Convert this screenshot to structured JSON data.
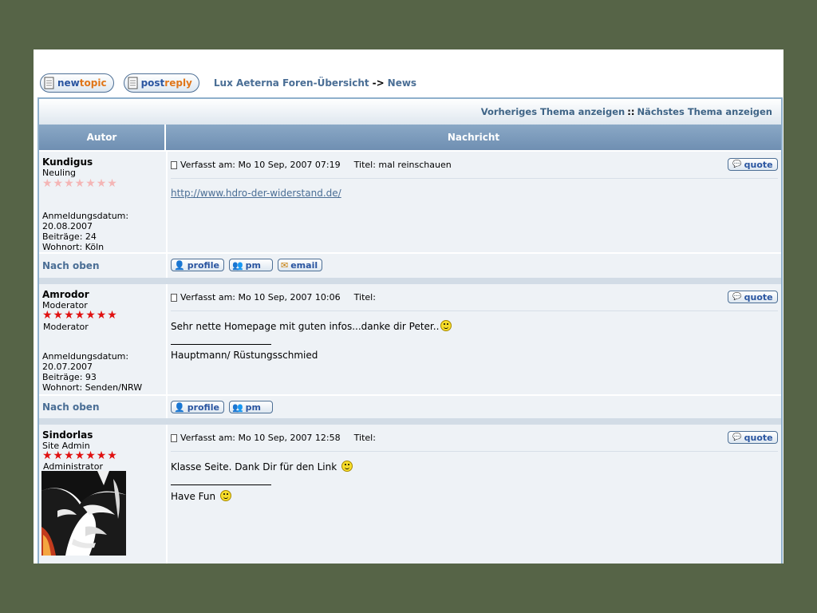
{
  "toolbar": {
    "newtopic_a": "new",
    "newtopic_b": "topic",
    "postreply_a": "post",
    "postreply_b": "reply",
    "breadcrumb_forum": "Lux Aeterna Foren-Übersicht",
    "breadcrumb_sep": "->",
    "breadcrumb_section": "News"
  },
  "nav": {
    "prev": "Vorheriges Thema anzeigen",
    "sep": "::",
    "next": "Nächstes Thema anzeigen"
  },
  "table": {
    "col_author": "Autor",
    "col_message": "Nachricht",
    "back_to_top": "Nach oben",
    "quote_label": "quote",
    "profile_label": "profile",
    "pm_label": "pm",
    "email_label": "email"
  },
  "posts": [
    {
      "author": "Kundigus",
      "rank": "Neuling",
      "stars": "★★★★★★★",
      "reg_label": "Anmeldungsdatum:",
      "reg_date": "20.08.2007",
      "posts_line": "Beiträge: 24",
      "location_line": "Wohnort: Köln",
      "meta": "Verfasst am: Mo 10 Sep, 2007 07:19",
      "title_line": "Titel: mal reinschauen",
      "body": "http://www.hdro-der-widerstand.de/"
    },
    {
      "author": "Amrodor",
      "rank": "Moderator",
      "stars": "★★★★★★★",
      "rank_image": "Moderator",
      "reg_label": "Anmeldungsdatum:",
      "reg_date": "20.07.2007",
      "posts_line": "Beiträge: 93",
      "location_line": "Wohnort: Senden/NRW",
      "meta": "Verfasst am: Mo 10 Sep, 2007 10:06",
      "title_line": "Titel:",
      "body": "Sehr nette Homepage mit guten infos...danke dir Peter..",
      "signature": "Hauptmann/ Rüstungsschmied"
    },
    {
      "author": "Sindorlas",
      "rank": "Site Admin",
      "stars": "★★★★★★★",
      "rank_image": "Administrator",
      "meta": "Verfasst am: Mo 10 Sep, 2007 12:58",
      "title_line": "Titel:",
      "body": "Klasse Seite. Dank Dir für den Link",
      "signature": "Have Fun"
    }
  ],
  "colors": {
    "background": "#566447",
    "link": "#4a6e95",
    "header": "#7a99bb",
    "row": "#eef2f6",
    "star": "#e01010"
  }
}
